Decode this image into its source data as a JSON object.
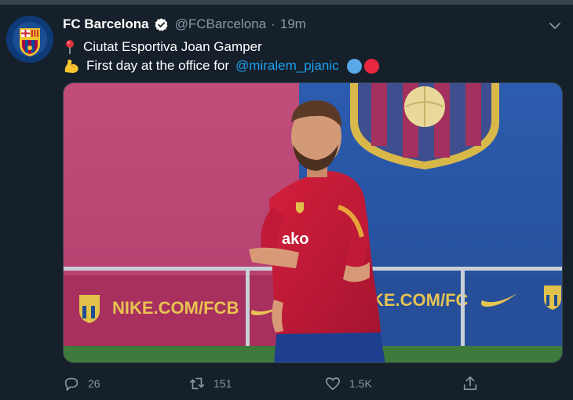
{
  "tweet": {
    "author_name": "FC Barcelona",
    "handle": "@FCBarcelona",
    "separator": "·",
    "time": "19m",
    "line1": {
      "icon": "round-pushpin-emoji",
      "text": "Ciutat Esportiva Joan Gamper"
    },
    "line2": {
      "icon": "flexed-biceps-emoji",
      "text": "First day at the office for",
      "mention": "@miralem_pjanic",
      "circle_colors": [
        "#5aa8e8",
        "#e8283e"
      ]
    },
    "media": {
      "banner_text_left": "NIKE.COM/FCB",
      "banner_text_right": "KE.COM/FC",
      "shirt_sponsor": "ako"
    },
    "stats": {
      "replies": "26",
      "retweets": "151",
      "likes": "1.5K"
    }
  },
  "colors": {
    "background": "#15202b",
    "text_secondary": "#8899a6",
    "link": "#1da1f2",
    "divider": "#38444d"
  },
  "icons": {
    "reply": "reply-icon",
    "retweet": "retweet-icon",
    "like": "heart-icon",
    "share": "share-icon",
    "verified": "verified-badge-icon",
    "menu": "chevron-down-icon"
  }
}
